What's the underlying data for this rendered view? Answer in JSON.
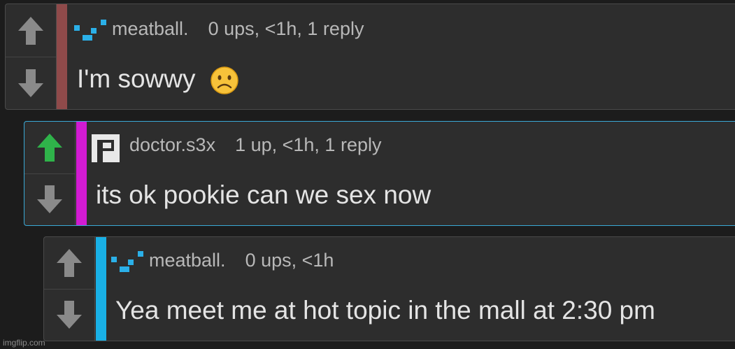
{
  "colors": {
    "background": "#1c1c1c",
    "card": "#2d2d2d",
    "stripe_meatball": "#8f4a4a",
    "stripe_doctor": "#d21bd2",
    "stripe_reply": "#19b0e6",
    "upvoted": "#2fb34a",
    "arrow": "#888888"
  },
  "comments": [
    {
      "username": "meatball.",
      "meta": "0 ups, <1h, 1 reply",
      "text": "I'm sowwy",
      "emoji": "frowning-face",
      "upvoted": false
    },
    {
      "username": "doctor.s3x",
      "meta": "1 up, <1h, 1 reply",
      "text": "its ok pookie can we sex now",
      "upvoted": true
    },
    {
      "username": "meatball.",
      "meta": "0 ups, <1h",
      "text": "Yea meet me at hot topic in the mall at 2:30 pm",
      "upvoted": false
    }
  ],
  "watermark": "imgflip.com"
}
